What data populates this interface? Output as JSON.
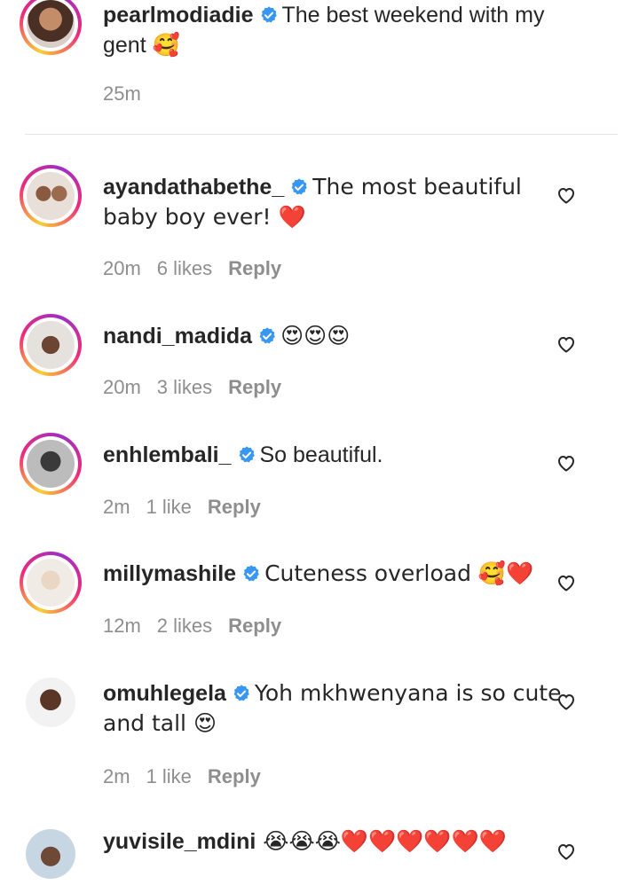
{
  "caption": {
    "username": "pearlmodiadie",
    "text": "The best weekend with my gent 🥰",
    "time": "25m"
  },
  "comments": [
    {
      "username": "ayandathabethe_",
      "text": "The most beautiful baby boy ever! ❤️",
      "time": "20m",
      "likes": "6 likes",
      "reply": "Reply"
    },
    {
      "username": "nandi_madida",
      "text": "😍😍😍",
      "time": "20m",
      "likes": "3 likes",
      "reply": "Reply"
    },
    {
      "username": "enhlembali_",
      "text": "So beautiful.",
      "time": "2m",
      "likes": "1 like",
      "reply": "Reply"
    },
    {
      "username": "millymashile",
      "text": "Cuteness overload 🥰❤️",
      "time": "12m",
      "likes": "2 likes",
      "reply": "Reply"
    },
    {
      "username": "omuhlegela",
      "text": "Yoh mkhwenyana is so cute and tall 😍",
      "time": "2m",
      "likes": "1 like",
      "reply": "Reply"
    },
    {
      "username": "yuvisile_mdini",
      "text": "😭😭😭❤️❤️❤️❤️❤️❤️",
      "time": "",
      "likes": "",
      "reply": ""
    }
  ],
  "colors": {
    "text": "#262626",
    "meta": "#8e8e8e",
    "verified": "#3897f0",
    "divider": "#e6e6e6"
  },
  "icons": {
    "verified": "verified-badge-icon",
    "like": "heart-outline-icon"
  }
}
